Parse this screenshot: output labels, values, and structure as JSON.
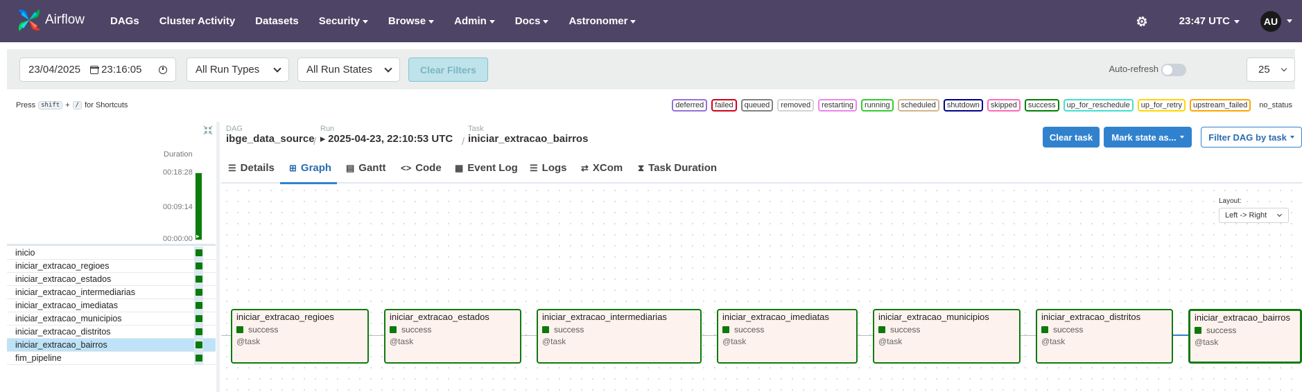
{
  "navbar": {
    "brand": "Airflow",
    "items": [
      {
        "label": "DAGs"
      },
      {
        "label": "Cluster Activity"
      },
      {
        "label": "Datasets"
      },
      {
        "label": "Security"
      },
      {
        "label": "Browse"
      },
      {
        "label": "Admin"
      },
      {
        "label": "Docs"
      },
      {
        "label": "Astronomer"
      }
    ],
    "time": "23:47 UTC",
    "user_initials": "AU"
  },
  "filters": {
    "date": "23/04/2025",
    "time": "23:16:05",
    "run_types": "All Run Types",
    "run_states": "All Run States",
    "clear_label": "Clear Filters",
    "autorefresh_label": "Auto-refresh",
    "autorefresh_on": false,
    "page_size": "25"
  },
  "shortcuts": {
    "press": "Press",
    "key1": "shift",
    "plus": "+",
    "key2": "/",
    "for": "for Shortcuts"
  },
  "legend": [
    {
      "label": "deferred",
      "color": "#9370db"
    },
    {
      "label": "failed",
      "color": "#d0021b"
    },
    {
      "label": "queued",
      "color": "#808080"
    },
    {
      "label": "removed",
      "color": "#d3d3d3"
    },
    {
      "label": "restarting",
      "color": "#ee82ee"
    },
    {
      "label": "running",
      "color": "#32cd32"
    },
    {
      "label": "scheduled",
      "color": "#d2b48c"
    },
    {
      "label": "shutdown",
      "color": "#00008b"
    },
    {
      "label": "skipped",
      "color": "#ff69b4"
    },
    {
      "label": "success",
      "color": "#008000"
    },
    {
      "label": "up_for_reschedule",
      "color": "#40e0d0"
    },
    {
      "label": "up_for_retry",
      "color": "#ffd700"
    },
    {
      "label": "upstream_failed",
      "color": "#ffa500"
    },
    {
      "label": "no_status",
      "color": ""
    }
  ],
  "grid": {
    "duration_label": "Duration",
    "ticks": [
      "00:18:28",
      "00:09:14",
      "00:00:00"
    ],
    "run_duration_fraction": 1.0,
    "tasks": [
      {
        "name": "inicio",
        "state": "success"
      },
      {
        "name": "iniciar_extracao_regioes",
        "state": "success"
      },
      {
        "name": "iniciar_extracao_estados",
        "state": "success"
      },
      {
        "name": "iniciar_extracao_intermediarias",
        "state": "success"
      },
      {
        "name": "iniciar_extracao_imediatas",
        "state": "success"
      },
      {
        "name": "iniciar_extracao_municipios",
        "state": "success"
      },
      {
        "name": "iniciar_extracao_distritos",
        "state": "success"
      },
      {
        "name": "iniciar_extracao_bairros",
        "state": "success",
        "selected": true
      },
      {
        "name": "fim_pipeline",
        "state": "success"
      }
    ]
  },
  "breadcrumb": {
    "dag_key": "DAG",
    "dag": "ibge_data_source",
    "run_key": "Run",
    "run": "2025-04-23, 22:10:53 UTC",
    "task_key": "Task",
    "task": "iniciar_extracao_bairros"
  },
  "actions": {
    "clear_task": "Clear task",
    "mark_state": "Mark state as...",
    "filter_dag": "Filter DAG by task"
  },
  "tabs": [
    {
      "label": "Details",
      "icon": "list-icon"
    },
    {
      "label": "Graph",
      "icon": "graph-icon",
      "active": true
    },
    {
      "label": "Gantt",
      "icon": "gantt-icon"
    },
    {
      "label": "Code",
      "icon": "code-icon"
    },
    {
      "label": "Event Log",
      "icon": "event-log-icon"
    },
    {
      "label": "Logs",
      "icon": "logs-icon"
    },
    {
      "label": "XCom",
      "icon": "xcom-icon"
    },
    {
      "label": "Task Duration",
      "icon": "hourglass-icon"
    }
  ],
  "graph": {
    "layout_label": "Layout:",
    "layout_value": "Left -> Right",
    "nodes": [
      {
        "name": "iniciar_extracao_regioes",
        "state": "success",
        "type": "@task"
      },
      {
        "name": "iniciar_extracao_estados",
        "state": "success",
        "type": "@task"
      },
      {
        "name": "iniciar_extracao_intermediarias",
        "state": "success",
        "type": "@task"
      },
      {
        "name": "iniciar_extracao_imediatas",
        "state": "success",
        "type": "@task"
      },
      {
        "name": "iniciar_extracao_municipios",
        "state": "success",
        "type": "@task"
      },
      {
        "name": "iniciar_extracao_distritos",
        "state": "success",
        "type": "@task"
      },
      {
        "name": "iniciar_extracao_bairros",
        "state": "success",
        "type": "@task",
        "selected": true
      }
    ]
  }
}
